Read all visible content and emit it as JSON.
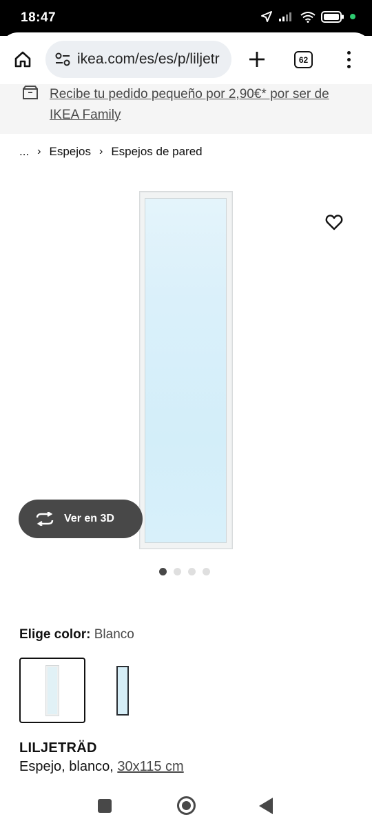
{
  "status_bar": {
    "time": "18:47"
  },
  "browser": {
    "url": "ikea.com/es/es/p/liljetr",
    "tab_count": "62"
  },
  "promo": {
    "text": "Recibe tu pedido pequeño por 2,90€* por ser de IKEA Family"
  },
  "breadcrumb": {
    "ellipsis": "...",
    "items": [
      "Espejos",
      "Espejos de pared"
    ]
  },
  "gallery": {
    "view3d_label": "Ver en 3D",
    "dot_count": 4,
    "active_dot": 0
  },
  "color": {
    "label": "Elige color:",
    "value": "Blanco",
    "options": [
      "white",
      "black"
    ],
    "selected": "white"
  },
  "product": {
    "name": "LILJETRÄD",
    "description_prefix": "Espejo, blanco,",
    "size": "30x115 cm"
  },
  "colors": {
    "accent_dark": "#484848",
    "status_green": "#2ecc71",
    "promo_bg": "#f5f5f5"
  }
}
